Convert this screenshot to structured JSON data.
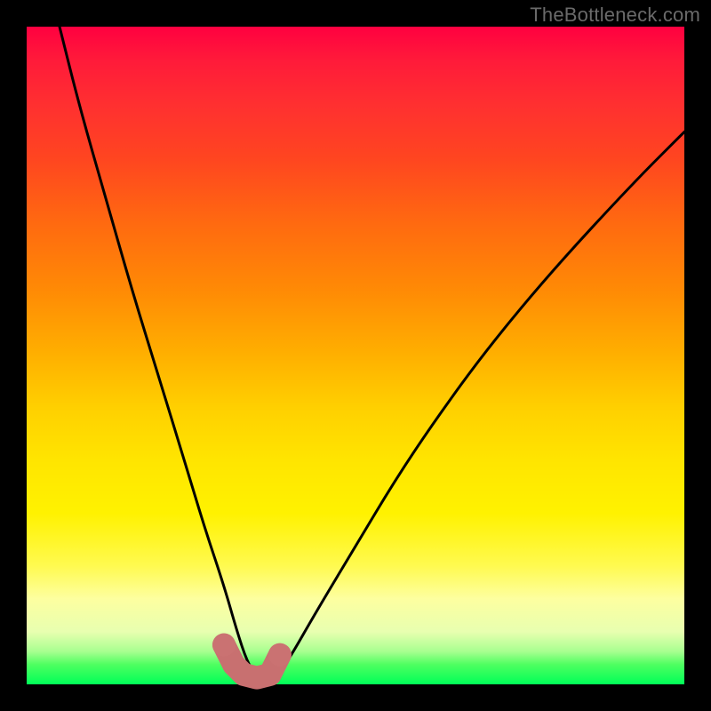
{
  "watermark": "TheBottleneck.com",
  "colors": {
    "page_bg": "#000000",
    "curve": "#000000",
    "points_stroke": "#c87070",
    "points_fill": "#ca7272",
    "gradient_stops": [
      "#ff0040",
      "#ff1a3a",
      "#ff3030",
      "#ff4520",
      "#ff6a10",
      "#ff8a05",
      "#ffb000",
      "#ffd000",
      "#ffe500",
      "#fff200",
      "#fffa50",
      "#fdffa0",
      "#e8ffb0",
      "#a8ff90",
      "#4eff60",
      "#00ff58"
    ]
  },
  "chart_data": {
    "type": "line",
    "title": "",
    "xlabel": "",
    "ylabel": "",
    "xlim": [
      0,
      100
    ],
    "ylim": [
      0,
      100
    ],
    "grid": false,
    "legend_position": "none",
    "series": [
      {
        "name": "curve",
        "x": [
          5,
          8,
          12,
          16,
          20,
          24,
          27,
          30,
          32,
          33.5,
          35,
          37,
          38.5,
          40,
          44,
          50,
          56,
          62,
          70,
          80,
          92,
          100
        ],
        "y": [
          100,
          88,
          74,
          60,
          47,
          34,
          24,
          15,
          8,
          3.5,
          1,
          1,
          2,
          4,
          11,
          21,
          31,
          40,
          51,
          63,
          76,
          84
        ]
      },
      {
        "name": "highlight-blob",
        "x": [
          30,
          31.5,
          33,
          35,
          37,
          38.5
        ],
        "y": [
          6,
          3,
          1.5,
          1,
          1.5,
          4.5
        ]
      }
    ],
    "annotations": []
  }
}
